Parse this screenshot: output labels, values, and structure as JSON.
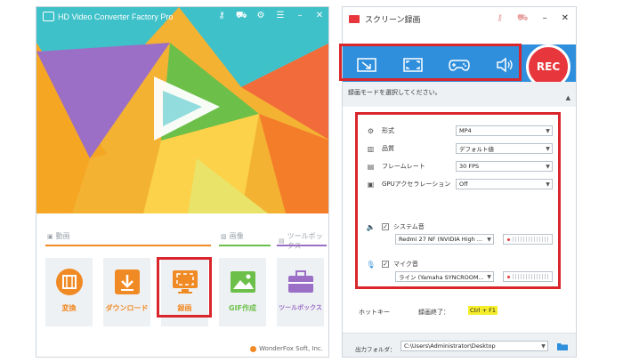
{
  "left_window": {
    "app_title": "HD Video Converter Factory Pro",
    "sections": [
      {
        "label": "動画"
      },
      {
        "label": "画像"
      },
      {
        "label": "ツールボックス"
      }
    ],
    "tiles": [
      {
        "label": "変換"
      },
      {
        "label": "ダウンロード"
      },
      {
        "label": "録画"
      },
      {
        "label": "GIF作成"
      },
      {
        "label": "ツールボックス"
      }
    ],
    "footer": "WonderFox Soft, Inc."
  },
  "right_window": {
    "title": "スクリーン録画",
    "rec_label": "REC",
    "hint": "録画モードを選択してください。",
    "settings": [
      {
        "label": "形式",
        "value": "MP4"
      },
      {
        "label": "品質",
        "value": "デフォルト値"
      },
      {
        "label": "フレームレート",
        "value": "30 FPS"
      },
      {
        "label": "GPUアクセラレーション",
        "value": "Off"
      }
    ],
    "system_audio": {
      "label": "システム音",
      "device": "Redmi 27 NF (NVIDIA High ..."
    },
    "mic_audio": {
      "label": "マイク音",
      "device": "ライン (Yamaha SYNCROOM..."
    },
    "hotkey_label": "ホットキー",
    "hotkey_action": "録画終了：",
    "hotkey_value": "Ctrl + F1",
    "output_label": "出力フォルダ：",
    "output_path": "C:\\Users\\Administrator\\Desktop"
  },
  "colors": {
    "accent_blue": "#2f8fdc",
    "rec_red": "#e8373c",
    "tile_orange": "#f08a24",
    "tile_green": "#6cc04a",
    "tile_purple": "#9b6fc6",
    "highlight_red": "#d9262c"
  }
}
